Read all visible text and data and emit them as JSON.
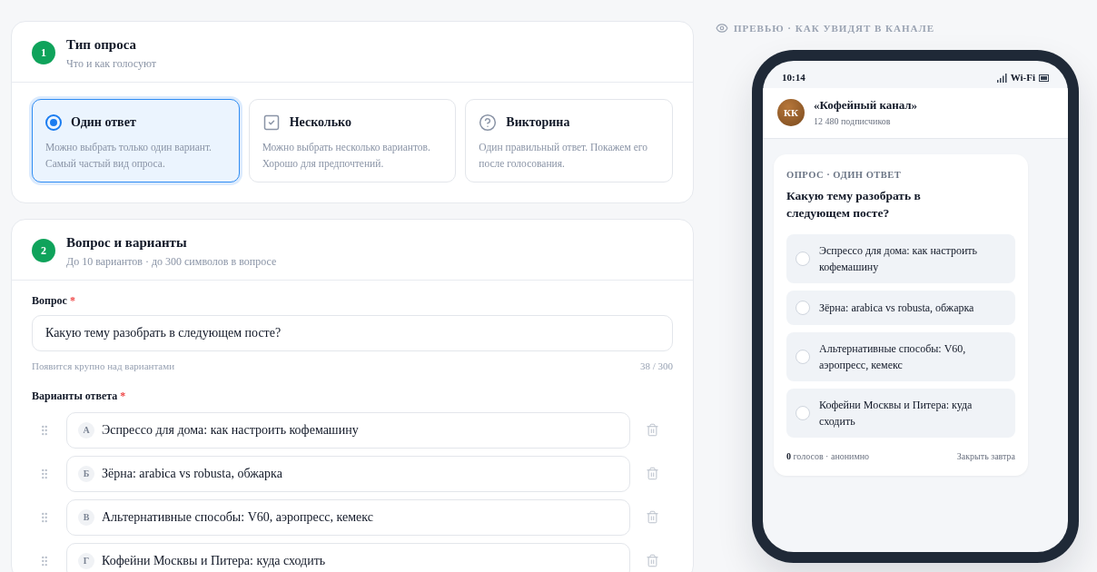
{
  "poll_type_section": {
    "step": "1",
    "title": "Тип опроса",
    "subtitle": "Что и как голосуют",
    "options": [
      {
        "kind": "radio",
        "label": "Один ответ",
        "description": "Можно выбрать только один вариант. Самый частый вид опроса.",
        "selected": true
      },
      {
        "kind": "checkbox",
        "label": "Несколько",
        "description": "Можно выбрать несколько вариантов. Хорошо для предпочтений.",
        "selected": false
      },
      {
        "kind": "quiz",
        "label": "Викторина",
        "description": "Один правильный ответ. Покажем его после голосования.",
        "selected": false
      }
    ]
  },
  "question_section": {
    "step": "2",
    "title": "Вопрос и варианты",
    "subtitle": "До 10 вариантов · до 300 символов в вопросе",
    "question": {
      "label": "Вопрос",
      "required_mark": "*",
      "value": "Какую тему разобрать в следующем посте?",
      "hint": "Появится крупно над вариантами",
      "counter": "38 / 300"
    },
    "answers_label": "Варианты ответа",
    "answers_required_mark": "*",
    "answers": [
      {
        "letter": "А",
        "value": "Эспрессо для дома: как настроить кофемашину"
      },
      {
        "letter": "Б",
        "value": "Зёрна: arabica vs robusta, обжарка"
      },
      {
        "letter": "В",
        "value": "Альтернативные способы: V60, аэропресс, кемекс"
      },
      {
        "letter": "Г",
        "value": "Кофейни Москвы и Питера: куда сходить"
      }
    ]
  },
  "preview": {
    "heading": "ПРЕВЬЮ · КАК УВИДЯТ В КАНАЛЕ",
    "status_bar": {
      "time": "10:14",
      "network": "Wi-Fi"
    },
    "channel": {
      "initials": "КК",
      "name": "«Кофейный канал»",
      "subscribers": "12 480 подписчиков"
    },
    "poll": {
      "type_label": "ОПРОС · ОДИН ОТВЕТ",
      "question": "Какую тему разобрать в следующем посте?",
      "options": [
        {
          "text": "Эспрессо для дома: как настроить кофемашину",
          "selected": false
        },
        {
          "text": "Зёрна: arabica vs robusta, обжарка",
          "selected": false
        },
        {
          "text": "Альтернативные способы: V60, аэропресс, кемекс",
          "selected": false
        },
        {
          "text": "Кофейни Москвы и Питера: куда сходить",
          "selected": false
        }
      ],
      "votes": "**0** голосов · анонимно",
      "close_note": "Закрыть завтра"
    }
  }
}
